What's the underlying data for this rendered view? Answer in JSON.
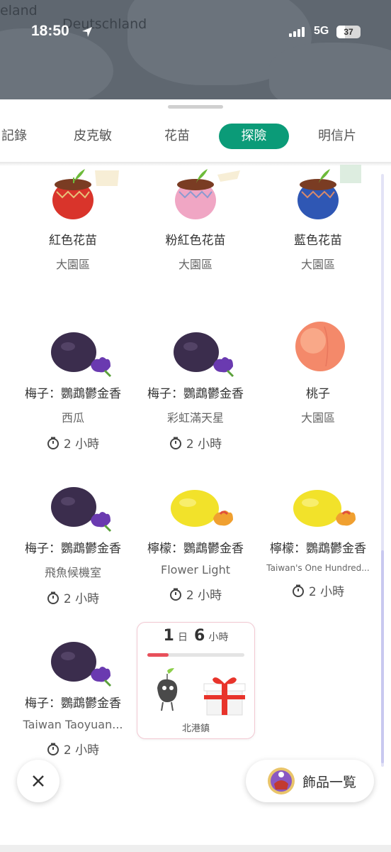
{
  "status_bar": {
    "time": "18:50",
    "network": "5G",
    "battery": "37"
  },
  "map": {
    "labels": [
      "eland",
      "Deutschland"
    ]
  },
  "tabs": [
    {
      "label": "記錄",
      "active": false
    },
    {
      "label": "皮克敏",
      "active": false
    },
    {
      "label": "花苗",
      "active": false
    },
    {
      "label": "探險",
      "active": true
    },
    {
      "label": "明信片",
      "active": false
    }
  ],
  "items": [
    {
      "name": "紅色花苗",
      "location": "大園區",
      "timer": "",
      "icon": "red-seedling-pot"
    },
    {
      "name": "粉紅色花苗",
      "location": "大園區",
      "timer": "",
      "icon": "pink-seedling-pot"
    },
    {
      "name": "藍色花苗",
      "location": "大園區",
      "timer": "",
      "icon": "blue-seedling-pot"
    },
    {
      "name": "梅子：鸚鵡鬱金香",
      "location": "西瓜",
      "timer": "2 小時",
      "icon": "plum-tulip"
    },
    {
      "name": "梅子：鸚鵡鬱金香",
      "location": "彩虹滿天星",
      "timer": "2 小時",
      "icon": "plum-tulip"
    },
    {
      "name": "桃子",
      "location": "大園區",
      "timer": "",
      "icon": "peach"
    },
    {
      "name": "梅子：鸚鵡鬱金香",
      "location": "飛魚候機室",
      "timer": "2 小時",
      "icon": "plum-tulip"
    },
    {
      "name": "檸檬：鸚鵡鬱金香",
      "location": "Flower Light",
      "timer": "2 小時",
      "icon": "lemon-tulip"
    },
    {
      "name": "檸檬：鸚鵡鬱金香",
      "location": "Taiwan's One Hundred...",
      "timer": "2 小時",
      "icon": "lemon-tulip"
    },
    {
      "name": "梅子：鸚鵡鬱金香",
      "location": "Taiwan Taoyuan...",
      "timer": "2 小時",
      "icon": "plum-tulip"
    }
  ],
  "expedition": {
    "days": "1",
    "days_unit": "日",
    "hours": "6",
    "hours_unit": "小時",
    "progress": 0.22,
    "location": "北港鎮",
    "icons": [
      "rock-pikmin",
      "gift-box"
    ]
  },
  "buttons": {
    "close_icon": "close-icon",
    "accessories_label": "飾品一覧"
  },
  "colors": {
    "accent": "#0b9b78",
    "progress": "#e8505b",
    "card_border": "#f2c8d2"
  }
}
